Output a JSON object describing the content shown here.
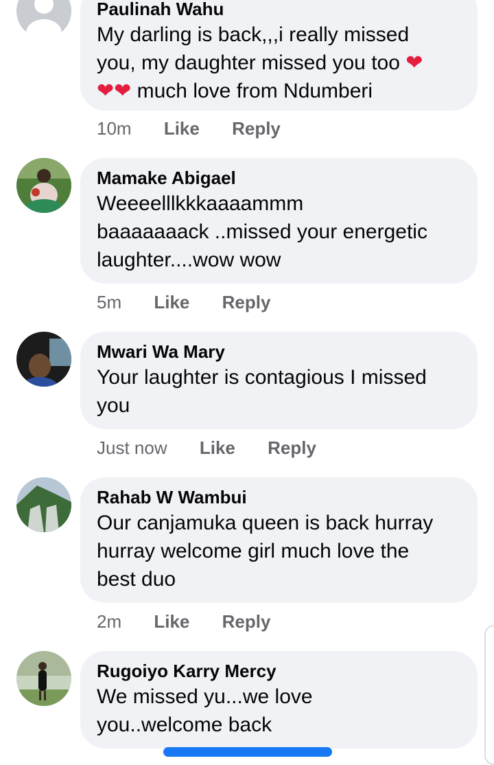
{
  "comments": [
    {
      "author": "Paulinah Wahu",
      "lines": [
        "My darling is back,,,i really missed",
        "you, my daughter missed you too",
        "much love from Ndumberi"
      ],
      "time": "10m",
      "like": "Like",
      "reply": "Reply"
    },
    {
      "author": "Mamake Abigael",
      "lines": [
        "Weeeelllkkkaaaammm",
        "baaaaaaack ..missed your energetic",
        "laughter....wow wow"
      ],
      "time": "5m",
      "like": "Like",
      "reply": "Reply"
    },
    {
      "author": "Mwari Wa Mary",
      "lines": [
        "Your laughter is contagious I missed",
        "you"
      ],
      "time": "Just now",
      "like": "Like",
      "reply": "Reply"
    },
    {
      "author": "Rahab W Wambui",
      "lines": [
        "Our canjamuka queen is back hurray",
        "hurray welcome girl much love the",
        "best duo"
      ],
      "time": "2m",
      "like": "Like",
      "reply": "Reply"
    },
    {
      "author": "Rugoiyo Karry Mercy",
      "lines": [
        "We missed yu...we love",
        "you..welcome back"
      ]
    }
  ],
  "colors": {
    "bubble": "#f0f2f5",
    "heart": "#e41e3f",
    "meta_text": "#65676b",
    "accent": "#1877f2"
  },
  "icons": [
    "red-heart-emoji"
  ]
}
